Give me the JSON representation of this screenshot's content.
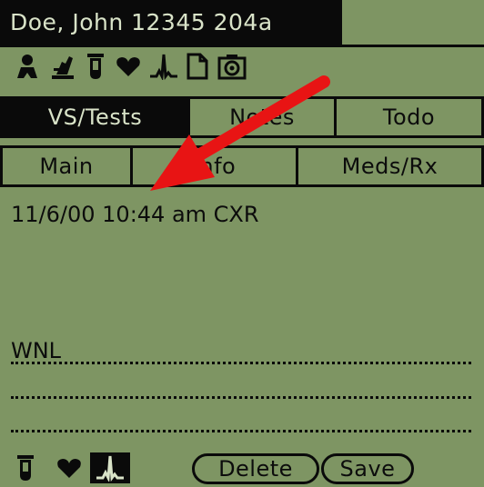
{
  "header": {
    "patient": "Doe, John 12345 204a"
  },
  "toolbar_icons": [
    "person-icon",
    "flask-icon",
    "test-tube-icon",
    "heart-icon",
    "ekg-icon",
    "document-icon",
    "camera-icon"
  ],
  "tabs_row1": [
    {
      "label": "VS/Tests",
      "active": true
    },
    {
      "label": "Notes",
      "active": false
    },
    {
      "label": "Todo",
      "active": false
    }
  ],
  "tabs_row2": [
    {
      "label": "Main",
      "active": false
    },
    {
      "label": "Info",
      "active": false
    },
    {
      "label": "Meds/Rx",
      "active": false
    }
  ],
  "note": {
    "entry": "11/6/00 10:44 am CXR",
    "result": "WNL"
  },
  "buttons": {
    "delete": "Delete",
    "save": "Save"
  },
  "bottom_icons": [
    "test-tube-icon",
    "heart-icon",
    "ekg-icon"
  ],
  "colors": {
    "screen": "#7E9563",
    "ink": "#0a0a0a",
    "arrow": "#E81414"
  }
}
